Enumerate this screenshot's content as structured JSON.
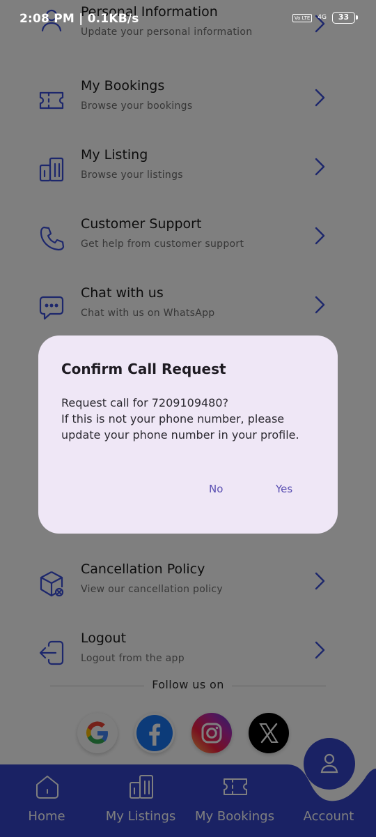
{
  "status_bar": {
    "time": "2:08 PM | 0.1KB/s",
    "volte": "Vo LTE",
    "network": "4G",
    "battery": "33"
  },
  "menu": [
    {
      "title": "Personal Information",
      "subtitle": "Update your personal information",
      "icon": "user-icon"
    },
    {
      "title": "My Bookings",
      "subtitle": "Browse your bookings",
      "icon": "ticket-icon"
    },
    {
      "title": "My Listing",
      "subtitle": "Browse your listings",
      "icon": "building-icon"
    },
    {
      "title": "Customer Support",
      "subtitle": "Get help from customer support",
      "icon": "phone-icon"
    },
    {
      "title": "Chat with us",
      "subtitle": "Chat with us on WhatsApp",
      "icon": "chat-icon"
    },
    {
      "title": "Cancellation Policy",
      "subtitle": "View our cancellation policy",
      "icon": "box-cancel-icon"
    },
    {
      "title": "Logout",
      "subtitle": "Logout from the app",
      "icon": "logout-icon"
    }
  ],
  "follow_label": "Follow us on",
  "social": [
    "google-icon",
    "facebook-icon",
    "instagram-icon",
    "x-icon"
  ],
  "bottom_nav": [
    {
      "label": "Home",
      "icon": "home-icon"
    },
    {
      "label": "My Listings",
      "icon": "building-icon"
    },
    {
      "label": "My Bookings",
      "icon": "ticket-icon"
    },
    {
      "label": "Account",
      "icon": "user-icon"
    }
  ],
  "dialog": {
    "title": "Confirm Call Request",
    "line1": "Request call for 7209109480?",
    "line2": "If this is not your phone number, please",
    "line3": "update your phone number in your profile.",
    "no_label": "No",
    "yes_label": "Yes"
  },
  "colors": {
    "accent": "#3b4fd8",
    "nav_bg": "#3544c8",
    "dialog_bg": "#efe7f6",
    "dialog_button": "#5a4fb2"
  }
}
